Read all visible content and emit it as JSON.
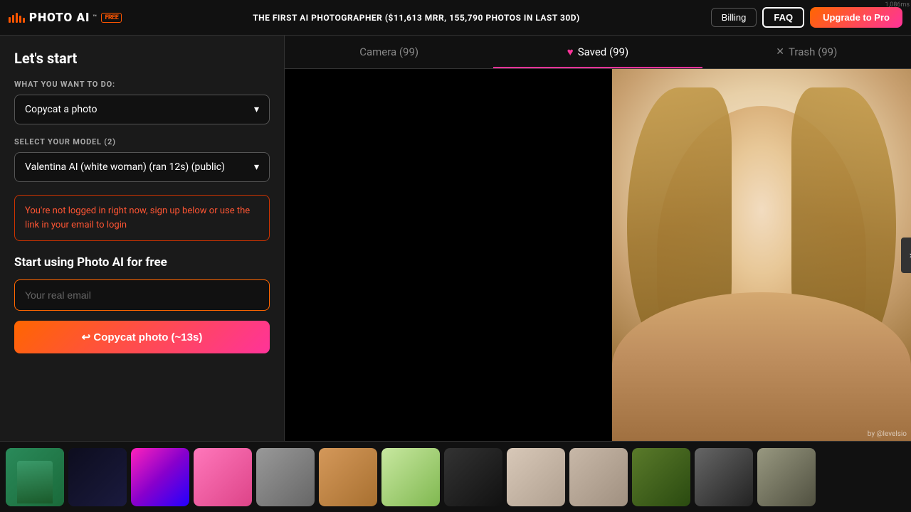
{
  "header": {
    "logo_text": "IIIIIPHOTO AI™",
    "logo_free": "FREE",
    "banner_text": "THE FIRST AI PHOTOGRAPHER ($11,613 MRR, 155,790 PHOTOS IN LAST 30D)",
    "billing_label": "Billing",
    "faq_label": "FAQ",
    "upgrade_label": "Upgrade to Pro",
    "visitor_count": "1,086ms"
  },
  "sidebar": {
    "title": "Let's start",
    "what_label": "WHAT YOU WANT TO DO:",
    "what_value": "Copycat a photo",
    "model_label": "SELECT YOUR MODEL (2)",
    "model_value": "Valentina AI (white woman) (ran 12s) (public)",
    "error_text": "You're not logged in right now, sign up below or use the link in your email to login",
    "cta_title": "Start using Photo AI for free",
    "email_placeholder": "Your real email",
    "copycat_btn": "↩ Copycat photo (~13s)"
  },
  "tabs": [
    {
      "label": "Camera (99)",
      "active": false,
      "icon": ""
    },
    {
      "label": "Saved (99)",
      "active": true,
      "icon": "♥"
    },
    {
      "label": "Trash (99)",
      "active": false,
      "icon": "✕"
    }
  ],
  "watermark": "by @levelsio",
  "thumbnails": [
    {
      "id": 1,
      "cls": "t1"
    },
    {
      "id": 2,
      "cls": "t2"
    },
    {
      "id": 3,
      "cls": "t3"
    },
    {
      "id": 4,
      "cls": "t4"
    },
    {
      "id": 5,
      "cls": "t5"
    },
    {
      "id": 6,
      "cls": "t6"
    },
    {
      "id": 7,
      "cls": "t7"
    },
    {
      "id": 8,
      "cls": "t8"
    },
    {
      "id": 9,
      "cls": "t9"
    },
    {
      "id": 10,
      "cls": "t10"
    },
    {
      "id": 11,
      "cls": "t11"
    },
    {
      "id": 12,
      "cls": "t12"
    },
    {
      "id": 13,
      "cls": "t13"
    }
  ]
}
